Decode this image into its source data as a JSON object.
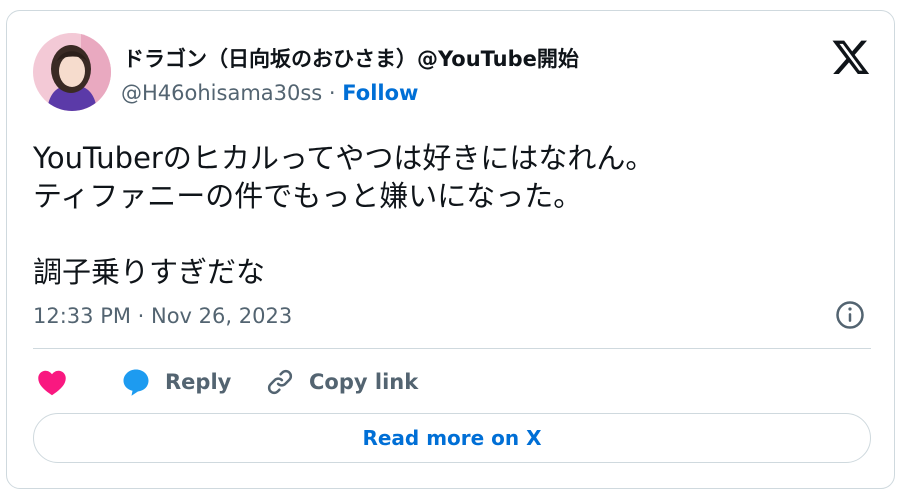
{
  "author": {
    "display_name": "ドラゴン（日向坂のおひさま）@YouTube開始",
    "handle": "@H46ohisama30ss",
    "separator": " · ",
    "follow_label": "Follow"
  },
  "tweet": {
    "lines": [
      "YouTuberのヒカルってやつは好きにはなれん。",
      "ティファニーの件でもっと嫌いになった。",
      "調子乗りすぎだな"
    ],
    "timestamp": "12:33 PM · Nov 26, 2023"
  },
  "actions": {
    "like_icon": "heart-icon",
    "reply_label": "Reply",
    "copy_link_label": "Copy link"
  },
  "read_more_label": "Read more on X",
  "colors": {
    "like": "#f91880",
    "reply": "#1d9bf0",
    "link": "#006fd6",
    "muted": "#536471",
    "text": "#0f1419",
    "border": "#cfd9de"
  }
}
